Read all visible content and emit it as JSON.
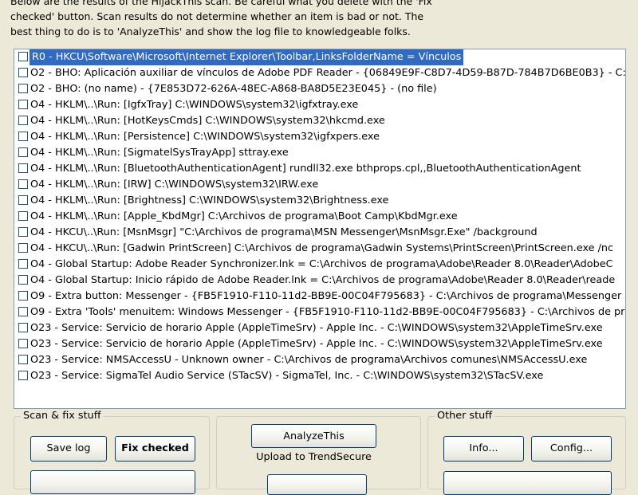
{
  "intro": {
    "line1": "Below are the results of the HijackThis scan. Be careful what you delete with the 'Fix",
    "line2": "checked' button. Scan results do not determine whether an item is bad or not. The",
    "line3": "best thing to do is to 'AnalyzeThis' and show the log file to knowledgeable folks."
  },
  "results": [
    {
      "text": "R0 - HKCU\\Software\\Microsoft\\Internet Explorer\\Toolbar,LinksFolderName = Vínculos",
      "selected": true
    },
    {
      "text": "O2 - BHO: Aplicación auxiliar de vínculos de Adobe PDF Reader - {06849E9F-C8D7-4D59-B87D-784B7D6BE0B3} - C:\\"
    },
    {
      "text": "O2 - BHO: (no name) - {7E853D72-626A-48EC-A868-BA8D5E23E045} - (no file)"
    },
    {
      "text": "O4 - HKLM\\..\\Run: [IgfxTray] C:\\WINDOWS\\system32\\igfxtray.exe"
    },
    {
      "text": "O4 - HKLM\\..\\Run: [HotKeysCmds] C:\\WINDOWS\\system32\\hkcmd.exe"
    },
    {
      "text": "O4 - HKLM\\..\\Run: [Persistence] C:\\WINDOWS\\system32\\igfxpers.exe"
    },
    {
      "text": "O4 - HKLM\\..\\Run: [SigmatelSysTrayApp] sttray.exe"
    },
    {
      "text": "O4 - HKLM\\..\\Run: [BluetoothAuthenticationAgent] rundll32.exe bthprops.cpl,,BluetoothAuthenticationAgent"
    },
    {
      "text": "O4 - HKLM\\..\\Run: [IRW] C:\\WINDOWS\\system32\\IRW.exe"
    },
    {
      "text": "O4 - HKLM\\..\\Run: [Brightness] C:\\WINDOWS\\system32\\Brightness.exe"
    },
    {
      "text": "O4 - HKLM\\..\\Run: [Apple_KbdMgr] C:\\Archivos de programa\\Boot Camp\\KbdMgr.exe"
    },
    {
      "text": "O4 - HKCU\\..\\Run: [MsnMsgr] \"C:\\Archivos de programa\\MSN Messenger\\MsnMsgr.Exe\" /background"
    },
    {
      "text": "O4 - HKCU\\..\\Run: [Gadwin PrintScreen] C:\\Archivos de programa\\Gadwin Systems\\PrintScreen\\PrintScreen.exe /nc"
    },
    {
      "text": "O4 - Global Startup: Adobe Reader Synchronizer.lnk = C:\\Archivos de programa\\Adobe\\Reader 8.0\\Reader\\AdobeC"
    },
    {
      "text": "O4 - Global Startup: Inicio rápido de Adobe Reader.lnk = C:\\Archivos de programa\\Adobe\\Reader 8.0\\Reader\\reade"
    },
    {
      "text": "O9 - Extra button: Messenger - {FB5F1910-F110-11d2-BB9E-00C04F795683} - C:\\Archivos de programa\\Messenger"
    },
    {
      "text": "O9 - Extra 'Tools' menuitem: Windows Messenger - {FB5F1910-F110-11d2-BB9E-00C04F795683} - C:\\Archivos de pr"
    },
    {
      "text": "O23 - Service: Servicio de horario Apple (AppleTimeSrv) - Apple Inc. - C:\\WINDOWS\\system32\\AppleTimeSrv.exe"
    },
    {
      "text": "O23 - Service: Servicio de horario Apple (AppleTimeSrv) - Apple Inc. - C:\\WINDOWS\\system32\\AppleTimeSrv.exe"
    },
    {
      "text": "O23 - Service: NMSAccessU - Unknown owner - C:\\Archivos de programa\\Archivos comunes\\NMSAccessU.exe"
    },
    {
      "text": "O23 - Service: SigmaTel Audio Service (STacSV) - SigmaTel, Inc. - C:\\WINDOWS\\system32\\STacSV.exe"
    }
  ],
  "groups": {
    "scan_fix": {
      "title": "Scan & fix stuff",
      "save_log": "Save log",
      "fix_checked": "Fix checked"
    },
    "middle": {
      "analyze": "AnalyzeThis",
      "upload_label": "Upload to TrendSecure"
    },
    "other": {
      "title": "Other stuff",
      "info": "Info...",
      "config": "Config..."
    }
  }
}
